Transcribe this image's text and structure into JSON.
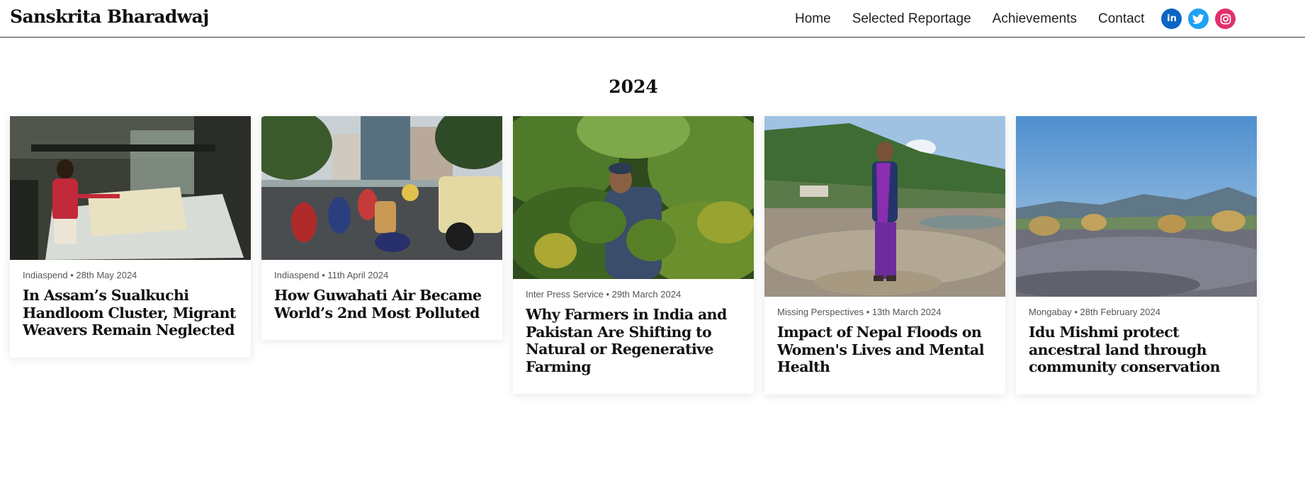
{
  "site": {
    "name": "Sanskrita Bharadwaj"
  },
  "nav": {
    "items": [
      "Home",
      "Selected Reportage",
      "Achievements",
      "Contact"
    ]
  },
  "social": [
    {
      "icon": "linkedin-icon",
      "glyph": "in",
      "color": "#0a66c2"
    },
    {
      "icon": "twitter-icon",
      "glyph": "",
      "color": "#1da1f2"
    },
    {
      "icon": "instagram-icon",
      "glyph": "",
      "color": "#e1306c"
    }
  ],
  "section": {
    "year": "2024"
  },
  "articles": [
    {
      "outlet": "Indiaspend",
      "date": "28th May 2024",
      "title": "In Assam’s Sualkuchi Handloom Cluster, Migrant Weavers Remain Neglected",
      "image": "weaver at handloom"
    },
    {
      "outlet": "Indiaspend",
      "date": "11th April 2024",
      "title": "How Guwahati Air Became World’s 2nd Most Polluted",
      "image": "city traffic"
    },
    {
      "outlet": "Inter Press Service",
      "date": "29th March 2024",
      "title": "Why Farmers in India and Pakistan Are Shifting to Natural or Regenerative Farming",
      "image": "farmer in greenery"
    },
    {
      "outlet": "Missing Perspectives",
      "date": "13th March 2024",
      "title": "Impact of Nepal Floods on Women's Lives and Mental Health",
      "image": "woman on riverbed"
    },
    {
      "outlet": "Mongabay",
      "date": "28th February 2024",
      "title": "Idu Mishmi protect ancestral land through community conservation",
      "image": "rocky riverbed landscape"
    }
  ]
}
